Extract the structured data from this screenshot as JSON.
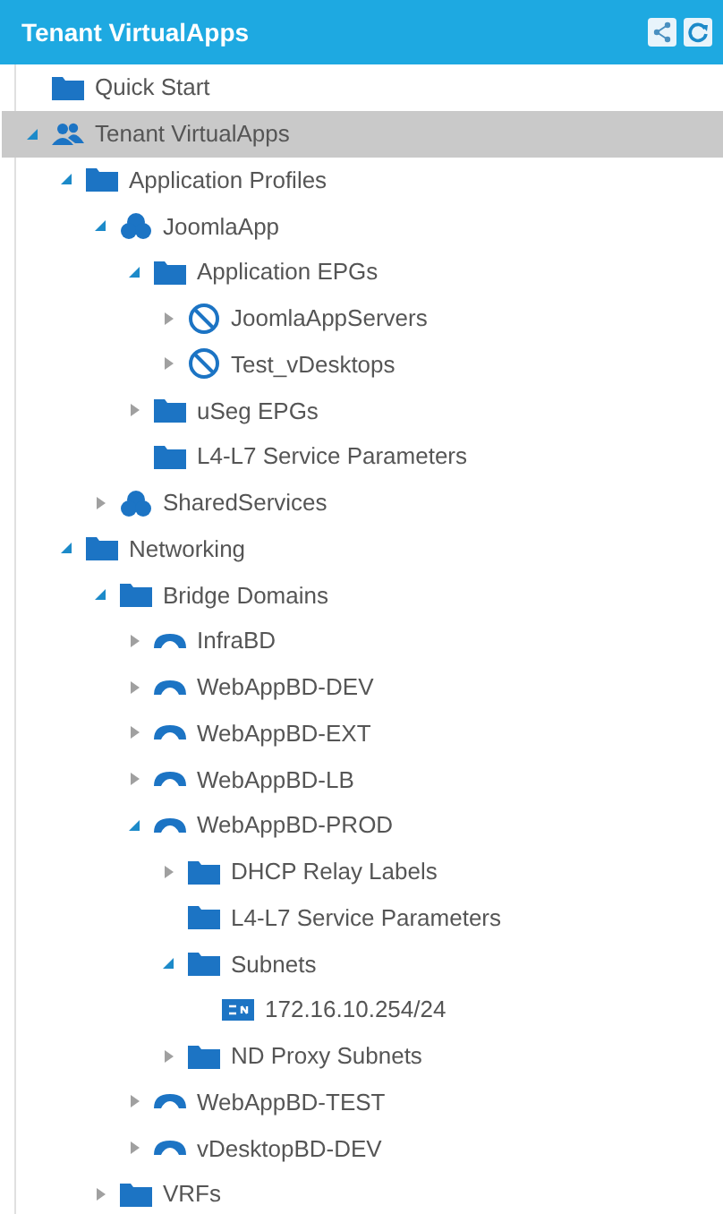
{
  "header": {
    "title": "Tenant VirtualApps"
  },
  "tree": [
    {
      "label": "Quick Start",
      "kind": "folder",
      "expandable": false,
      "selected": false
    },
    {
      "label": "Tenant VirtualApps",
      "kind": "tenant",
      "expandable": true,
      "expanded": true,
      "selected": true,
      "children": [
        {
          "label": "Application Profiles",
          "kind": "folder",
          "expandable": true,
          "expanded": true,
          "selected": false,
          "children": [
            {
              "label": "JoomlaApp",
              "kind": "app",
              "expandable": true,
              "expanded": true,
              "selected": false,
              "children": [
                {
                  "label": "Application EPGs",
                  "kind": "folder",
                  "expandable": true,
                  "expanded": true,
                  "selected": false,
                  "children": [
                    {
                      "label": "JoomlaAppServers",
                      "kind": "epg",
                      "expandable": true,
                      "expanded": false,
                      "selected": false
                    },
                    {
                      "label": "Test_vDesktops",
                      "kind": "epg",
                      "expandable": true,
                      "expanded": false,
                      "selected": false
                    }
                  ]
                },
                {
                  "label": "uSeg EPGs",
                  "kind": "folder",
                  "expandable": true,
                  "expanded": false,
                  "selected": false
                },
                {
                  "label": "L4-L7 Service Parameters",
                  "kind": "folder",
                  "expandable": false,
                  "selected": false
                }
              ]
            },
            {
              "label": "SharedServices",
              "kind": "app",
              "expandable": true,
              "expanded": false,
              "selected": false
            }
          ]
        },
        {
          "label": "Networking",
          "kind": "folder",
          "expandable": true,
          "expanded": true,
          "selected": false,
          "children": [
            {
              "label": "Bridge Domains",
              "kind": "folder",
              "expandable": true,
              "expanded": true,
              "selected": false,
              "children": [
                {
                  "label": "InfraBD",
                  "kind": "bd",
                  "expandable": true,
                  "expanded": false,
                  "selected": false
                },
                {
                  "label": "WebAppBD-DEV",
                  "kind": "bd",
                  "expandable": true,
                  "expanded": false,
                  "selected": false
                },
                {
                  "label": "WebAppBD-EXT",
                  "kind": "bd",
                  "expandable": true,
                  "expanded": false,
                  "selected": false
                },
                {
                  "label": "WebAppBD-LB",
                  "kind": "bd",
                  "expandable": true,
                  "expanded": false,
                  "selected": false
                },
                {
                  "label": "WebAppBD-PROD",
                  "kind": "bd",
                  "expandable": true,
                  "expanded": true,
                  "selected": false,
                  "children": [
                    {
                      "label": "DHCP Relay Labels",
                      "kind": "folder",
                      "expandable": true,
                      "expanded": false,
                      "selected": false
                    },
                    {
                      "label": "L4-L7 Service Parameters",
                      "kind": "folder",
                      "expandable": false,
                      "selected": false
                    },
                    {
                      "label": "Subnets",
                      "kind": "folder",
                      "expandable": true,
                      "expanded": true,
                      "selected": false,
                      "children": [
                        {
                          "label": "172.16.10.254/24",
                          "kind": "subnet",
                          "expandable": false,
                          "selected": false
                        }
                      ]
                    },
                    {
                      "label": "ND Proxy Subnets",
                      "kind": "folder",
                      "expandable": true,
                      "expanded": false,
                      "selected": false
                    }
                  ]
                },
                {
                  "label": "WebAppBD-TEST",
                  "kind": "bd",
                  "expandable": true,
                  "expanded": false,
                  "selected": false
                },
                {
                  "label": "vDesktopBD-DEV",
                  "kind": "bd",
                  "expandable": true,
                  "expanded": false,
                  "selected": false
                }
              ]
            },
            {
              "label": "VRFs",
              "kind": "folder",
              "expandable": true,
              "expanded": false,
              "selected": false
            }
          ]
        }
      ]
    }
  ]
}
